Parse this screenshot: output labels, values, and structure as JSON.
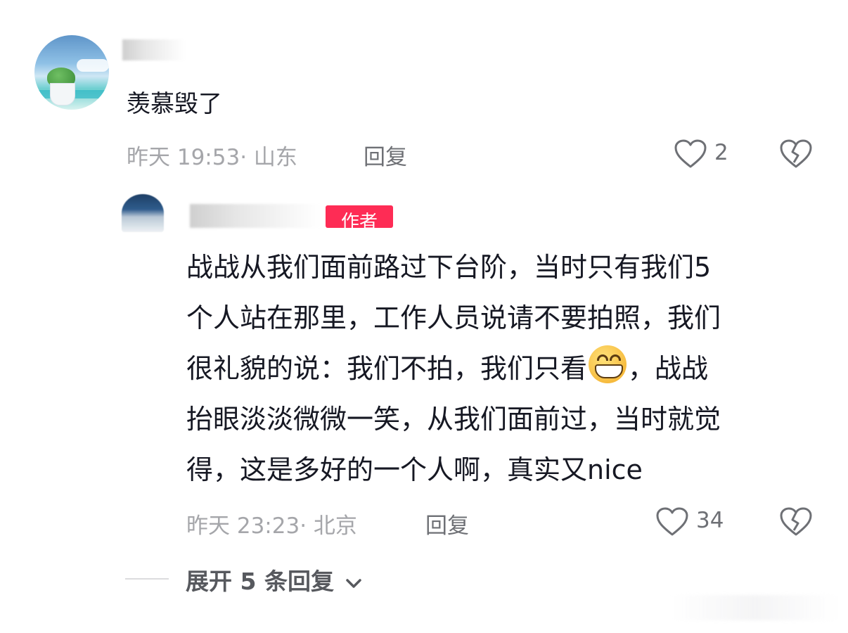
{
  "comment": {
    "text": "羡慕毁了",
    "time_location": "昨天 19:53· 山东",
    "reply_label": "回复",
    "like_count": "2"
  },
  "reply": {
    "author_badge": "作者",
    "lines": [
      "战战从我们面前路过下台阶，当时只有我们5",
      "个人站在那里，工作人员说请不要拍照，我们",
      "很礼貌的说：我们不拍，我们只看",
      "，战战",
      "抬眼淡淡微微一笑，从我们面前过，当时就觉",
      "得，这是多好的一个人啊，真实又nice"
    ],
    "time_location": "昨天 23:23· 北京",
    "reply_label": "回复",
    "like_count": "34"
  },
  "expand_label": "展开 5 条回复",
  "icons": {
    "like": "heart-outline-icon",
    "dislike": "broken-heart-icon",
    "expand": "chevron-down-icon",
    "emoji": "grinning-face-emoji"
  },
  "colors": {
    "text": "#161823",
    "meta": "#a5a6aa",
    "action": "#6e7075",
    "badge": "#fe2c55"
  }
}
